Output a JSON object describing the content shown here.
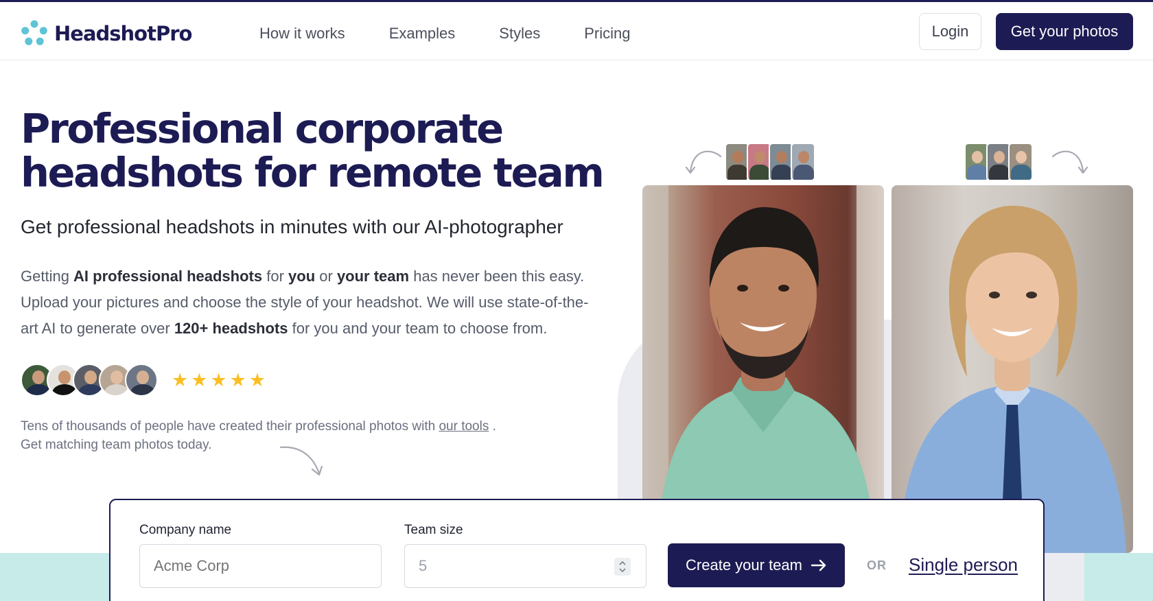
{
  "header": {
    "logo_text": "HeadshotPro",
    "nav": [
      "How it works",
      "Examples",
      "Styles",
      "Pricing"
    ],
    "login_label": "Login",
    "cta_label": "Get your photos"
  },
  "hero": {
    "title_line1": "Professional corporate",
    "title_line2": "headshots for remote team",
    "subtitle": "Get professional headshots in minutes with our AI-photographer",
    "desc": {
      "p1": "Getting ",
      "b1": "AI professional headshots",
      "p2": " for ",
      "b2": "you",
      "p3": " or ",
      "b3": "your team",
      "p4": " has never been this easy. Upload your pictures and choose the style of your headshot. We will use state-of-the-art AI to generate over ",
      "b4": "120+ headshots",
      "p5": " for you and your team to choose from."
    },
    "rating_stars": 5,
    "social_proof": {
      "text1": "Tens of thousands of people have created their professional photos with ",
      "link": "our tools",
      "text2": " . Get matching team photos today."
    }
  },
  "form": {
    "company_label": "Company name",
    "company_placeholder": "Acme Corp",
    "team_label": "Team size",
    "team_value": "5",
    "create_label": "Create your team",
    "or_label": "OR",
    "single_label": "Single person"
  },
  "colors": {
    "brand": "#1d1b53",
    "star": "#fbbf24",
    "teal": "#c6ebe9",
    "logo_accent": "#5ec4d6"
  },
  "icons": [
    "logo-icon",
    "arrow-right-icon",
    "stepper-icon",
    "star-icon",
    "curved-arrow-icon"
  ]
}
